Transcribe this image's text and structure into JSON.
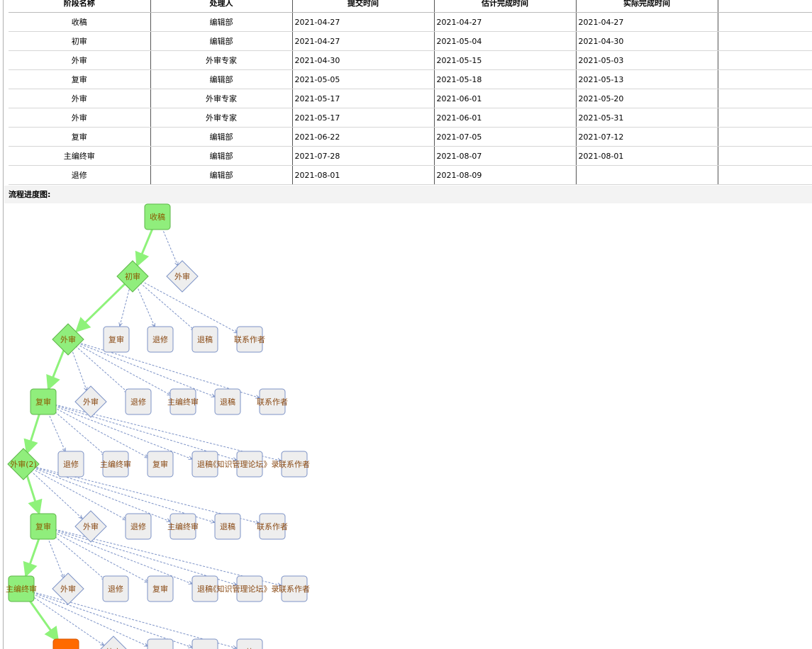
{
  "table": {
    "headers": [
      "阶段名称",
      "处理人",
      "提交时间",
      "估计完成时间",
      "实际完成时间",
      ""
    ],
    "rows": [
      [
        "收稿",
        "编辑部",
        "2021-04-27",
        "2021-04-27",
        "2021-04-27",
        ""
      ],
      [
        "初审",
        "编辑部",
        "2021-04-27",
        "2021-05-04",
        "2021-04-30",
        ""
      ],
      [
        "外审",
        "外审专家",
        "2021-04-30",
        "2021-05-15",
        "2021-05-03",
        ""
      ],
      [
        "复审",
        "编辑部",
        "2021-05-05",
        "2021-05-18",
        "2021-05-13",
        ""
      ],
      [
        "外审",
        "外审专家",
        "2021-05-17",
        "2021-06-01",
        "2021-05-20",
        ""
      ],
      [
        "外审",
        "外审专家",
        "2021-05-17",
        "2021-06-01",
        "2021-05-31",
        ""
      ],
      [
        "复审",
        "编辑部",
        "2021-06-22",
        "2021-07-05",
        "2021-07-12",
        ""
      ],
      [
        "主编终审",
        "编辑部",
        "2021-07-28",
        "2021-08-07",
        "2021-08-01",
        ""
      ],
      [
        "退修",
        "编辑部",
        "2021-08-01",
        "2021-08-09",
        "",
        ""
      ]
    ]
  },
  "section_title": "流程进度图:",
  "colors": {
    "done_fill": "#90ee7c",
    "done_stroke": "#5cb548",
    "todo_fill": "#eeeeee",
    "todo_stroke": "#7d93c7",
    "current_fill": "#ff6a00",
    "path_line": "#8ef27a",
    "option_line": "#7d93c7",
    "done_text": "#8a5a00",
    "todo_text": "#8a4a14"
  },
  "flow": {
    "nodes": [
      {
        "id": "n0",
        "label": "收稿",
        "shape": "rect",
        "state": "done"
      },
      {
        "id": "n1",
        "label": "初审",
        "shape": "diamond",
        "state": "done"
      },
      {
        "id": "n1a",
        "label": "外审",
        "shape": "diamond",
        "state": "todo"
      },
      {
        "id": "n2",
        "label": "外审",
        "shape": "diamond",
        "state": "done"
      },
      {
        "id": "n2a",
        "label": "复审",
        "shape": "rect",
        "state": "todo"
      },
      {
        "id": "n2b",
        "label": "退修",
        "shape": "rect",
        "state": "todo"
      },
      {
        "id": "n2c",
        "label": "退稿",
        "shape": "rect",
        "state": "todo"
      },
      {
        "id": "n2d",
        "label": "联系作者",
        "shape": "rect",
        "state": "todo"
      },
      {
        "id": "n3",
        "label": "复审",
        "shape": "rect",
        "state": "done"
      },
      {
        "id": "n3a",
        "label": "外审",
        "shape": "diamond",
        "state": "todo"
      },
      {
        "id": "n3b",
        "label": "退修",
        "shape": "rect",
        "state": "todo"
      },
      {
        "id": "n3c",
        "label": "主编终审",
        "shape": "rect",
        "state": "todo"
      },
      {
        "id": "n3d",
        "label": "退稿",
        "shape": "rect",
        "state": "todo"
      },
      {
        "id": "n3e",
        "label": "联系作者",
        "shape": "rect",
        "state": "todo"
      },
      {
        "id": "n4",
        "label": "外审(2)",
        "shape": "diamond",
        "state": "done"
      },
      {
        "id": "n4a",
        "label": "退修",
        "shape": "rect",
        "state": "todo"
      },
      {
        "id": "n4b",
        "label": "主编终审",
        "shape": "rect",
        "state": "todo"
      },
      {
        "id": "n4c",
        "label": "复审",
        "shape": "rect",
        "state": "todo"
      },
      {
        "id": "n4d",
        "label": "退稿",
        "shape": "rect",
        "state": "todo"
      },
      {
        "id": "n4e",
        "label": "《知识管理论坛》录",
        "shape": "rect",
        "state": "todo"
      },
      {
        "id": "n4f",
        "label": "联系作者",
        "shape": "rect",
        "state": "todo"
      },
      {
        "id": "n5",
        "label": "复审",
        "shape": "rect",
        "state": "done"
      },
      {
        "id": "n5a",
        "label": "外审",
        "shape": "diamond",
        "state": "todo"
      },
      {
        "id": "n5b",
        "label": "退修",
        "shape": "rect",
        "state": "todo"
      },
      {
        "id": "n5c",
        "label": "主编终审",
        "shape": "rect",
        "state": "todo"
      },
      {
        "id": "n5d",
        "label": "退稿",
        "shape": "rect",
        "state": "todo"
      },
      {
        "id": "n5e",
        "label": "联系作者",
        "shape": "rect",
        "state": "todo"
      },
      {
        "id": "n6",
        "label": "主编终审",
        "shape": "rect",
        "state": "done"
      },
      {
        "id": "n6a",
        "label": "外审",
        "shape": "diamond",
        "state": "todo"
      },
      {
        "id": "n6b",
        "label": "退修",
        "shape": "rect",
        "state": "todo"
      },
      {
        "id": "n6c",
        "label": "复审",
        "shape": "rect",
        "state": "todo"
      },
      {
        "id": "n6d",
        "label": "退稿",
        "shape": "rect",
        "state": "todo"
      },
      {
        "id": "n6e",
        "label": "《知识管理论坛》录",
        "shape": "rect",
        "state": "todo"
      },
      {
        "id": "n6f",
        "label": "联系作者",
        "shape": "rect",
        "state": "todo"
      },
      {
        "id": "n7",
        "label": "",
        "shape": "rect",
        "state": "current"
      },
      {
        "id": "n7a",
        "label": "外审",
        "shape": "diamond",
        "state": "todo"
      },
      {
        "id": "n7b",
        "label": "",
        "shape": "rect",
        "state": "todo"
      },
      {
        "id": "n7c",
        "label": "",
        "shape": "rect",
        "state": "todo"
      },
      {
        "id": "n7d",
        "label": "外",
        "shape": "rect",
        "state": "todo"
      }
    ],
    "path_edges": [
      [
        "n0",
        "n1"
      ],
      [
        "n1",
        "n2"
      ],
      [
        "n2",
        "n3"
      ],
      [
        "n3",
        "n4"
      ],
      [
        "n4",
        "n5"
      ],
      [
        "n5",
        "n6"
      ],
      [
        "n6",
        "n7"
      ]
    ],
    "option_edges": [
      [
        "n0",
        "n1a"
      ],
      [
        "n1",
        "n2a"
      ],
      [
        "n1",
        "n2b"
      ],
      [
        "n1",
        "n2c"
      ],
      [
        "n1",
        "n2d"
      ],
      [
        "n2",
        "n3a"
      ],
      [
        "n2",
        "n3b"
      ],
      [
        "n2",
        "n3c"
      ],
      [
        "n2",
        "n3d"
      ],
      [
        "n2",
        "n3e"
      ],
      [
        "n3",
        "n4a"
      ],
      [
        "n3",
        "n4b"
      ],
      [
        "n3",
        "n4c"
      ],
      [
        "n3",
        "n4d"
      ],
      [
        "n3",
        "n4e"
      ],
      [
        "n3",
        "n4f"
      ],
      [
        "n4",
        "n5a"
      ],
      [
        "n4",
        "n5b"
      ],
      [
        "n4",
        "n5c"
      ],
      [
        "n4",
        "n5d"
      ],
      [
        "n4",
        "n5e"
      ],
      [
        "n5",
        "n6a"
      ],
      [
        "n5",
        "n6b"
      ],
      [
        "n5",
        "n6c"
      ],
      [
        "n5",
        "n6d"
      ],
      [
        "n5",
        "n6e"
      ],
      [
        "n5",
        "n6f"
      ],
      [
        "n6",
        "n7a"
      ],
      [
        "n6",
        "n7b"
      ],
      [
        "n6",
        "n7c"
      ],
      [
        "n6",
        "n7d"
      ]
    ]
  }
}
